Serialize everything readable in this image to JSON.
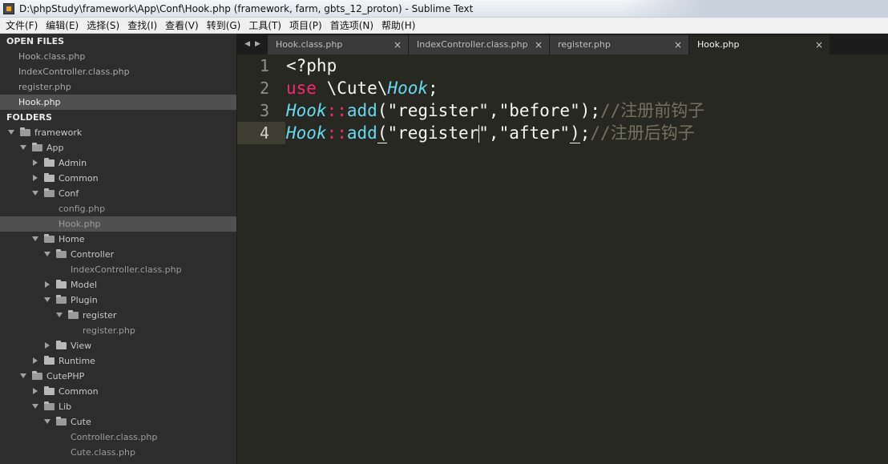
{
  "window": {
    "title": "D:\\phpStudy\\framework\\App\\Conf\\Hook.php (framework, farm, gbts_12_proton) - Sublime Text"
  },
  "menu": [
    "文件(F)",
    "编辑(E)",
    "选择(S)",
    "查找(I)",
    "查看(V)",
    "转到(G)",
    "工具(T)",
    "项目(P)",
    "首选项(N)",
    "帮助(H)"
  ],
  "sidebar": {
    "open_files_title": "OPEN FILES",
    "open_files": [
      "Hook.class.php",
      "IndexController.class.php",
      "register.php",
      "Hook.php"
    ],
    "folders_title": "FOLDERS",
    "tree": [
      {
        "label": "framework",
        "depth": 0,
        "kind": "folder",
        "open": true
      },
      {
        "label": "App",
        "depth": 1,
        "kind": "folder",
        "open": true
      },
      {
        "label": "Admin",
        "depth": 2,
        "kind": "folder",
        "open": false
      },
      {
        "label": "Common",
        "depth": 2,
        "kind": "folder",
        "open": false
      },
      {
        "label": "Conf",
        "depth": 2,
        "kind": "folder",
        "open": true
      },
      {
        "label": "config.php",
        "depth": 3,
        "kind": "file"
      },
      {
        "label": "Hook.php",
        "depth": 3,
        "kind": "file",
        "selected": true
      },
      {
        "label": "Home",
        "depth": 2,
        "kind": "folder",
        "open": true
      },
      {
        "label": "Controller",
        "depth": 3,
        "kind": "folder",
        "open": true
      },
      {
        "label": "IndexController.class.php",
        "depth": 4,
        "kind": "file"
      },
      {
        "label": "Model",
        "depth": 3,
        "kind": "folder",
        "open": false
      },
      {
        "label": "Plugin",
        "depth": 3,
        "kind": "folder",
        "open": true
      },
      {
        "label": "register",
        "depth": 4,
        "kind": "folder",
        "open": true
      },
      {
        "label": "register.php",
        "depth": 5,
        "kind": "file"
      },
      {
        "label": "View",
        "depth": 3,
        "kind": "folder",
        "open": false
      },
      {
        "label": "Runtime",
        "depth": 2,
        "kind": "folder",
        "open": false
      },
      {
        "label": "CutePHP",
        "depth": 1,
        "kind": "folder",
        "open": true
      },
      {
        "label": "Common",
        "depth": 2,
        "kind": "folder",
        "open": false
      },
      {
        "label": "Lib",
        "depth": 2,
        "kind": "folder",
        "open": true
      },
      {
        "label": "Cute",
        "depth": 3,
        "kind": "folder",
        "open": true
      },
      {
        "label": "Controller.class.php",
        "depth": 4,
        "kind": "file"
      },
      {
        "label": "Cute.class.php",
        "depth": 4,
        "kind": "file"
      }
    ]
  },
  "tabs": [
    {
      "label": "Hook.class.php",
      "active": false,
      "close": "×"
    },
    {
      "label": "IndexController.class.php",
      "active": false,
      "close": "×"
    },
    {
      "label": "register.php",
      "active": false,
      "close": "×"
    },
    {
      "label": "Hook.php",
      "active": true,
      "close": "×"
    }
  ],
  "tab_nav": {
    "prev": "◀",
    "next": "▶"
  },
  "editor": {
    "line_numbers": [
      "1",
      "2",
      "3",
      "4"
    ],
    "current_line": "4",
    "lines": [
      [
        {
          "t": "<?php",
          "c": "plain"
        }
      ],
      [
        {
          "t": "use",
          "c": "kw"
        },
        {
          "t": " \\Cute",
          "c": "plain"
        },
        {
          "t": "\\",
          "c": "plain"
        },
        {
          "t": "Hook",
          "c": "cls"
        },
        {
          "t": ";",
          "c": "plain"
        }
      ],
      [
        {
          "t": "Hook",
          "c": "cls"
        },
        {
          "t": "::",
          "c": "op"
        },
        {
          "t": "add",
          "c": "fn"
        },
        {
          "t": "(",
          "c": "plain"
        },
        {
          "t": "\"register\"",
          "c": "str-w"
        },
        {
          "t": ",",
          "c": "plain"
        },
        {
          "t": "\"before\"",
          "c": "str-w"
        },
        {
          "t": ");",
          "c": "plain"
        },
        {
          "t": "//注册前钩子",
          "c": "cm"
        }
      ],
      [
        {
          "t": "Hook",
          "c": "cls"
        },
        {
          "t": "::",
          "c": "op"
        },
        {
          "t": "add",
          "c": "fn"
        },
        {
          "t": "(",
          "c": "plain",
          "underline": true
        },
        {
          "t": "\"register",
          "c": "str-w"
        },
        {
          "t": "caret",
          "c": "caret"
        },
        {
          "t": "\"",
          "c": "str-w"
        },
        {
          "t": ",",
          "c": "plain"
        },
        {
          "t": "\"after\"",
          "c": "str-w"
        },
        {
          "t": ")",
          "c": "plain",
          "underline": true
        },
        {
          "t": ";",
          "c": "plain"
        },
        {
          "t": "//注册后钩子",
          "c": "cm"
        }
      ]
    ]
  },
  "colors": {
    "editor_bg": "#272822",
    "sidebar_bg": "#2d2d2d",
    "keyword": "#f92672",
    "class": "#66d9ef",
    "comment": "#75715e"
  }
}
